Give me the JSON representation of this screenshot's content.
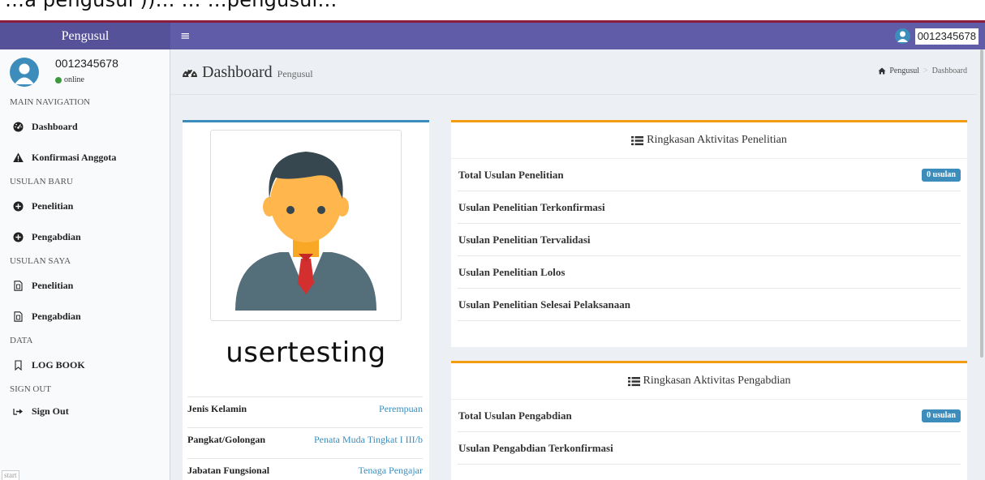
{
  "top_strip_text": "…a pengusul ))…      …      …pengusul…",
  "header": {
    "brand": "Pengusul",
    "toggle": "≡",
    "user": "0012345678"
  },
  "sidebar": {
    "user_name": "0012345678",
    "status": "online",
    "sections": {
      "main": "MAIN NAVIGATION",
      "baru": "USULAN BARU",
      "saya": "USULAN SAYA",
      "data": "DATA",
      "signout": "SIGN OUT"
    },
    "items": {
      "dashboard": "Dashboard",
      "konfirmasi": "Konfirmasi Anggota",
      "penelitian_baru": "Penelitian",
      "pengabdian_baru": "Pengabdian",
      "penelitian_saya": "Penelitian",
      "pengabdian_saya": "Pengabdian",
      "logbook": "LOG BOOK",
      "signout": "Sign Out"
    }
  },
  "content_header": {
    "title": "Dashboard",
    "subtitle": "Pengusul",
    "breadcrumb": [
      "Pengusul",
      "Dashboard"
    ]
  },
  "profile": {
    "username": "usertesting",
    "rows": [
      {
        "label": "Jenis Kelamin",
        "value": "Perempuan"
      },
      {
        "label": "Pangkat/Golongan",
        "value": "Penata Muda Tingkat I III/b"
      },
      {
        "label": "Jabatan Fungsional",
        "value": "Tenaga Pengajar"
      }
    ]
  },
  "penelitian_box": {
    "title": "Ringkasan Aktivitas Penelitian",
    "items": [
      {
        "label": "Total Usulan Penelitian",
        "badge": "0 usulan"
      },
      {
        "label": "Usulan Penelitian Terkonfirmasi",
        "badge": ""
      },
      {
        "label": "Usulan Penelitian Tervalidasi",
        "badge": ""
      },
      {
        "label": "Usulan Penelitian Lolos",
        "badge": ""
      },
      {
        "label": "Usulan Penelitian Selesai Pelaksanaan",
        "badge": ""
      }
    ]
  },
  "pengabdian_box": {
    "title": "Ringkasan Aktivitas Pengabdian",
    "items": [
      {
        "label": "Total Usulan Pengabdian",
        "badge": "0 usulan"
      },
      {
        "label": "Usulan Pengabdian Terkonfirmasi",
        "badge": ""
      }
    ]
  },
  "corner_tag": "start",
  "colors": {
    "header": "#605ca8",
    "brand": "#555299",
    "primary": "#3c8dbc",
    "warning": "#f39c12",
    "online": "#3c9a3c"
  }
}
